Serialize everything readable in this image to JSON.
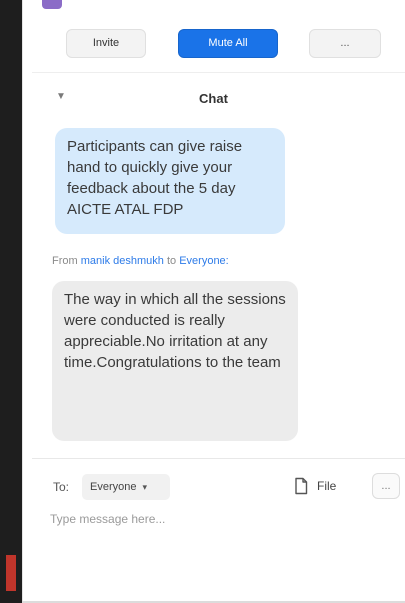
{
  "participants": {
    "invite_label": "Invite",
    "mute_all_label": "Mute All",
    "more_label": "..."
  },
  "chat": {
    "title": "Chat",
    "collapse_icon": "chevron-down-icon",
    "messages": [
      {
        "type": "sent",
        "text": "Participants can give raise hand to quickly give your feedback about the 5 day AICTE ATAL FDP"
      },
      {
        "type": "received",
        "from_prefix": "From",
        "sender": "manik deshmukh",
        "to_word": "to",
        "recipient": "Everyone:",
        "text": "The way in which all the sessions were conducted is really appreciable.No irritation at any time.Congratulations to the team"
      }
    ]
  },
  "composer": {
    "to_label": "To:",
    "recipient_value": "Everyone",
    "recipient_caret": "▾",
    "file_label": "File",
    "more_label": "...",
    "placeholder": "Type message here..."
  },
  "colors": {
    "accent": "#1a73e8",
    "sent_bubble": "#d6eafc",
    "received_bubble": "#ececec",
    "link": "#2d7be8"
  }
}
